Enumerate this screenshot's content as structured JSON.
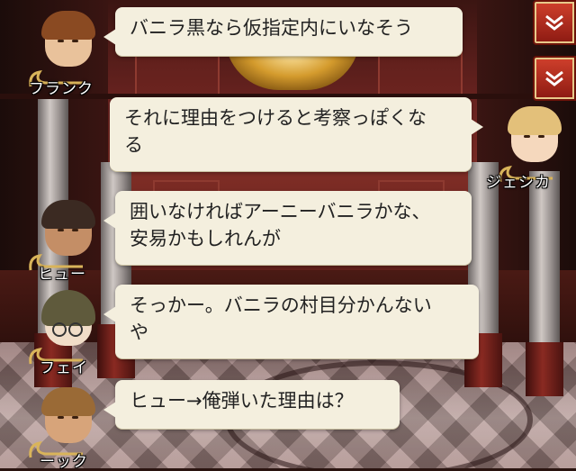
{
  "controls": {
    "collapse_icon": "chevron-double-down",
    "scroll_icon": "chevron-double-down",
    "accent": "#c0321f"
  },
  "dialogue": [
    {
      "speaker": "フランク",
      "side": "left",
      "line1": "バニラ黒なら仮指定内にいなそう",
      "line2": ""
    },
    {
      "speaker": "ジェシカ",
      "side": "right",
      "line1": "それに理由をつけると考察っぽくな",
      "line2": "る"
    },
    {
      "speaker": "ヒュー",
      "side": "left",
      "line1": "囲いなければアーニーバニラかな、",
      "line2": "安易かもしれんが"
    },
    {
      "speaker": "フェイ",
      "side": "left",
      "line1": "そっかー。バニラの村目分かんない",
      "line2": "や"
    },
    {
      "speaker": "ーック",
      "side": "left",
      "line1": "ヒュー→俺弾いた理由は？",
      "line2": ""
    }
  ]
}
